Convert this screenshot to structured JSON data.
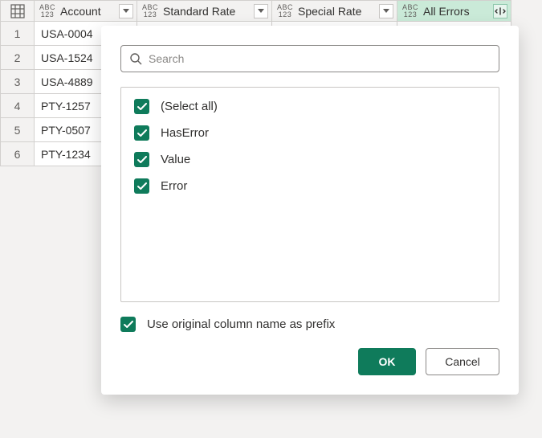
{
  "columns": {
    "account": "Account",
    "standard_rate": "Standard Rate",
    "special_rate": "Special Rate",
    "all_errors": "All Errors"
  },
  "rows": [
    {
      "num": "1",
      "account": "USA-0004"
    },
    {
      "num": "2",
      "account": "USA-1524"
    },
    {
      "num": "3",
      "account": "USA-4889"
    },
    {
      "num": "4",
      "account": "PTY-1257"
    },
    {
      "num": "5",
      "account": "PTY-0507"
    },
    {
      "num": "6",
      "account": "PTY-1234"
    }
  ],
  "popup": {
    "search_placeholder": "Search",
    "select_all": "(Select all)",
    "options": {
      "has_error": "HasError",
      "value": "Value",
      "error": "Error"
    },
    "use_prefix": "Use original column name as prefix",
    "ok": "OK",
    "cancel": "Cancel"
  }
}
